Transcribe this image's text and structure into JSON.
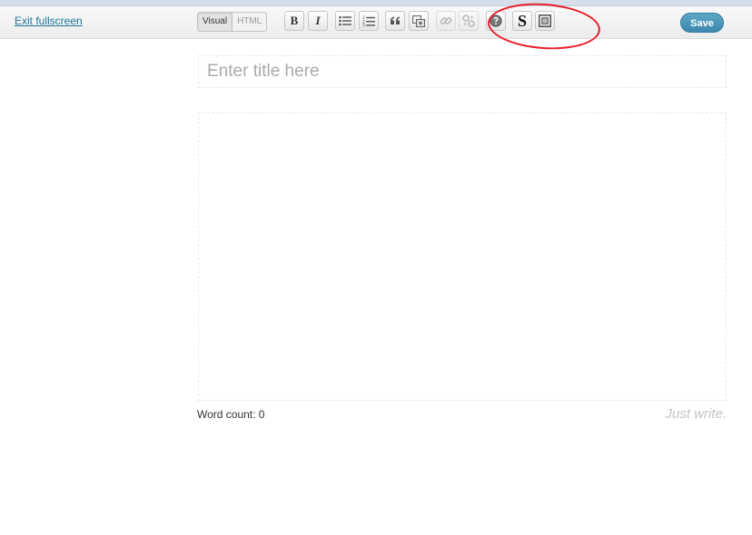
{
  "toolbar": {
    "exit_label": "Exit fullscreen",
    "modes": [
      "Visual",
      "HTML"
    ],
    "save_label": "Save",
    "buttons": {
      "bold": "B",
      "italic": "I",
      "bullet_list_icon": "bullet-list-icon",
      "numbered_list_icon": "numbered-list-icon",
      "blockquote_icon": "blockquote-icon",
      "media_icon": "media-icon",
      "link_icon": "link-icon",
      "unlink_icon": "unlink-icon",
      "help_icon": "help-icon",
      "s_label": "S",
      "frame_icon": "frame-icon"
    }
  },
  "editor": {
    "title_placeholder": "Enter title here",
    "word_count_label": "Word count: 0",
    "tagline": "Just write."
  },
  "colors": {
    "link": "#21759b",
    "save_button": "#3b89ad",
    "highlight": "#e81e28"
  }
}
